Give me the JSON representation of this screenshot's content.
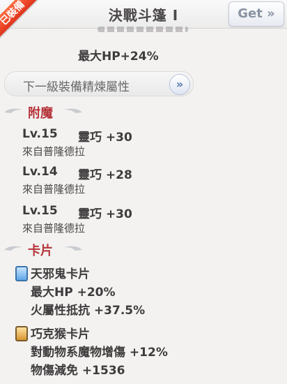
{
  "header": {
    "title": "決戰斗篷 I",
    "ribbon": "已裝備",
    "get_label": "Get »"
  },
  "stats": {
    "max_hp": "最大HP+24%"
  },
  "refine": {
    "label": "下一級裝備精煉屬性",
    "arrow": "»"
  },
  "enchant": {
    "title": "附魔",
    "items": [
      {
        "level": "Lv.15",
        "attr": "靈巧 +30",
        "source": "來自普隆德拉"
      },
      {
        "level": "Lv.14",
        "attr": "靈巧 +28",
        "source": "來自普隆德拉"
      },
      {
        "level": "Lv.15",
        "attr": "靈巧 +30",
        "source": "來自普隆德拉"
      }
    ]
  },
  "cards": {
    "title": "卡片",
    "items": [
      {
        "name": "天邪鬼卡片",
        "lines": [
          "最大HP +20%",
          "火屬性抵抗 +37.5%"
        ]
      },
      {
        "name": "巧克猴卡片",
        "lines": [
          "對動物系魔物增傷 +12%",
          "物傷減免 +1536"
        ]
      }
    ]
  }
}
